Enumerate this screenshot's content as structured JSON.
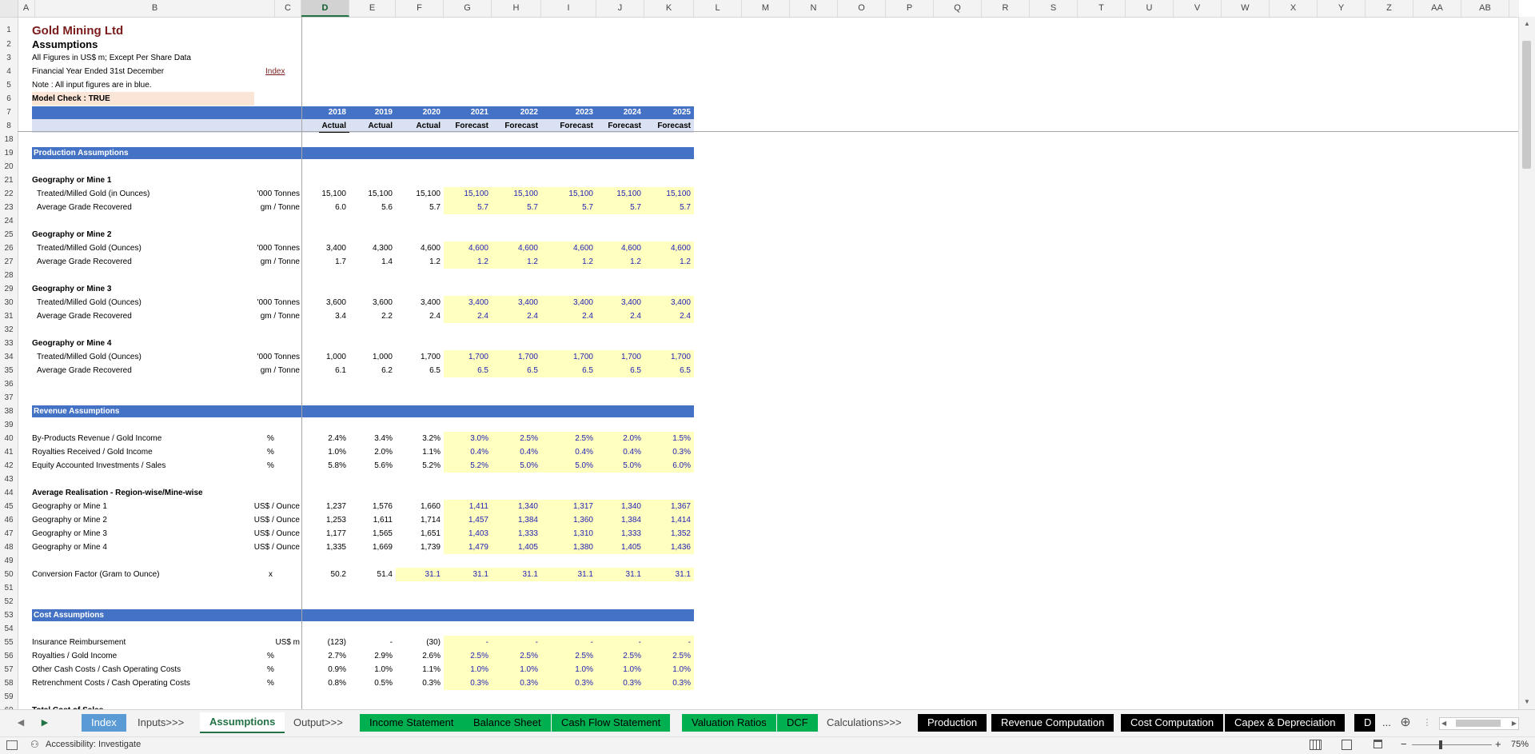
{
  "colors": {
    "band": "#4472c4",
    "header_light": "#d9e1f2",
    "input_fill": "#ffffc0",
    "input_text": "#1f1fb4",
    "title": "#7b1c1c",
    "check_fill": "#fbe5d6",
    "tab_green": "#00b050",
    "tab_black": "#000000",
    "tab_blue": "#5b9bd5",
    "selected_col": "#217346"
  },
  "column_letters": [
    "A",
    "B",
    "C",
    "D",
    "E",
    "F",
    "G",
    "H",
    "I",
    "J",
    "K",
    "L",
    "M",
    "N",
    "O",
    "P",
    "Q",
    "R",
    "S",
    "T",
    "U",
    "V",
    "W",
    "X",
    "Y",
    "Z",
    "AA",
    "AB"
  ],
  "row_numbers": [
    1,
    2,
    3,
    4,
    5,
    6,
    7,
    8,
    18,
    19,
    20,
    21,
    22,
    23,
    24,
    25,
    26,
    27,
    28,
    29,
    30,
    31,
    32,
    33,
    34,
    35,
    36,
    37,
    38,
    39,
    40,
    41,
    42,
    43,
    44,
    45,
    46,
    47,
    48,
    49,
    50,
    51,
    52,
    53,
    54,
    55,
    56,
    57,
    58,
    59,
    60
  ],
  "header": {
    "company": "Gold Mining Ltd",
    "sheet_title": "Assumptions",
    "note1": "All Figures in US$ m; Except Per Share Data",
    "note2": "Financial Year Ended 31st December",
    "index_link": "Index",
    "note3": "Note :  All input figures are in blue.",
    "model_check": "Model Check : TRUE",
    "years": [
      "2018",
      "2019",
      "2020",
      "2021",
      "2022",
      "2023",
      "2024",
      "2025"
    ],
    "statuses": [
      "Actual",
      "Actual",
      "Actual",
      "Forecast",
      "Forecast",
      "Forecast",
      "Forecast",
      "Forecast"
    ]
  },
  "sections": {
    "production": "Production Assumptions",
    "revenue": "Revenue Assumptions",
    "cost": "Cost Assumptions"
  },
  "production": {
    "mine1": {
      "title": "Geography or Mine 1",
      "rows": [
        {
          "label": "Treated/Milled Gold (in Ounces)",
          "unit": "'000 Tonnes",
          "values": [
            "15,100",
            "15,100",
            "15,100",
            "15,100",
            "15,100",
            "15,100",
            "15,100",
            "15,100"
          ]
        },
        {
          "label": "Average Grade Recovered",
          "unit": "gm / Tonne",
          "values": [
            "6.0",
            "5.6",
            "5.7",
            "5.7",
            "5.7",
            "5.7",
            "5.7",
            "5.7"
          ]
        }
      ]
    },
    "mine2": {
      "title": "Geography or Mine 2",
      "rows": [
        {
          "label": "Treated/Milled Gold (Ounces)",
          "unit": "'000 Tonnes",
          "values": [
            "3,400",
            "4,300",
            "4,600",
            "4,600",
            "4,600",
            "4,600",
            "4,600",
            "4,600"
          ]
        },
        {
          "label": "Average Grade Recovered",
          "unit": "gm / Tonne",
          "values": [
            "1.7",
            "1.4",
            "1.2",
            "1.2",
            "1.2",
            "1.2",
            "1.2",
            "1.2"
          ]
        }
      ]
    },
    "mine3": {
      "title": "Geography or Mine 3",
      "rows": [
        {
          "label": "Treated/Milled Gold (Ounces)",
          "unit": "'000 Tonnes",
          "values": [
            "3,600",
            "3,600",
            "3,400",
            "3,400",
            "3,400",
            "3,400",
            "3,400",
            "3,400"
          ]
        },
        {
          "label": "Average Grade Recovered",
          "unit": "gm / Tonne",
          "values": [
            "3.4",
            "2.2",
            "2.4",
            "2.4",
            "2.4",
            "2.4",
            "2.4",
            "2.4"
          ]
        }
      ]
    },
    "mine4": {
      "title": "Geography or Mine 4",
      "rows": [
        {
          "label": "Treated/Milled Gold (Ounces)",
          "unit": "'000 Tonnes",
          "values": [
            "1,000",
            "1,000",
            "1,700",
            "1,700",
            "1,700",
            "1,700",
            "1,700",
            "1,700"
          ]
        },
        {
          "label": "Average Grade Recovered",
          "unit": "gm / Tonne",
          "values": [
            "6.1",
            "6.2",
            "6.5",
            "6.5",
            "6.5",
            "6.5",
            "6.5",
            "6.5"
          ]
        }
      ]
    }
  },
  "revenue": {
    "ratios": [
      {
        "label": "By-Products Revenue / Gold Income",
        "unit": "%",
        "values": [
          "2.4%",
          "3.4%",
          "3.2%",
          "3.0%",
          "2.5%",
          "2.5%",
          "2.0%",
          "1.5%"
        ]
      },
      {
        "label": "Royalties Received / Gold Income",
        "unit": "%",
        "values": [
          "1.0%",
          "2.0%",
          "1.1%",
          "0.4%",
          "0.4%",
          "0.4%",
          "0.4%",
          "0.3%"
        ]
      },
      {
        "label": "Equity Accounted Investments / Sales",
        "unit": "%",
        "values": [
          "5.8%",
          "5.6%",
          "5.2%",
          "5.2%",
          "5.0%",
          "5.0%",
          "5.0%",
          "6.0%"
        ]
      }
    ],
    "realisation_title": "Average Realisation - Region-wise/Mine-wise",
    "realisation": [
      {
        "label": "Geography or Mine 1",
        "unit": "US$ / Ounce",
        "values": [
          "1,237",
          "1,576",
          "1,660",
          "1,411",
          "1,340",
          "1,317",
          "1,340",
          "1,367"
        ]
      },
      {
        "label": "Geography or Mine 2",
        "unit": "US$ / Ounce",
        "values": [
          "1,253",
          "1,611",
          "1,714",
          "1,457",
          "1,384",
          "1,360",
          "1,384",
          "1,414"
        ]
      },
      {
        "label": "Geography or Mine 3",
        "unit": "US$ / Ounce",
        "values": [
          "1,177",
          "1,565",
          "1,651",
          "1,403",
          "1,333",
          "1,310",
          "1,333",
          "1,352"
        ]
      },
      {
        "label": "Geography or Mine 4",
        "unit": "US$ / Ounce",
        "values": [
          "1,335",
          "1,669",
          "1,739",
          "1,479",
          "1,405",
          "1,380",
          "1,405",
          "1,436"
        ]
      }
    ],
    "conversion": {
      "label": "Conversion Factor (Gram to Ounce)",
      "unit": "x",
      "values": [
        "50.2",
        "51.4",
        "31.1",
        "31.1",
        "31.1",
        "31.1",
        "31.1",
        "31.1"
      ]
    }
  },
  "cost": {
    "rows": [
      {
        "label": "Insurance Reimbursement",
        "unit": "US$ m",
        "values": [
          "(123)",
          "-",
          "(30)",
          "-",
          "-",
          "-",
          "-",
          "-"
        ]
      },
      {
        "label": "Royalties / Gold Income",
        "unit": "%",
        "values": [
          "2.7%",
          "2.9%",
          "2.6%",
          "2.5%",
          "2.5%",
          "2.5%",
          "2.5%",
          "2.5%"
        ]
      },
      {
        "label": "Other Cash Costs / Cash Operating Costs",
        "unit": "%",
        "values": [
          "0.9%",
          "1.0%",
          "1.1%",
          "1.0%",
          "1.0%",
          "1.0%",
          "1.0%",
          "1.0%"
        ]
      },
      {
        "label": "Retrenchment Costs / Cash Operating Costs",
        "unit": "%",
        "values": [
          "0.8%",
          "0.5%",
          "0.3%",
          "0.3%",
          "0.3%",
          "0.3%",
          "0.3%",
          "0.3%"
        ]
      }
    ],
    "total_partial": "Total Cost of Sales"
  },
  "tabs": [
    {
      "label": "Index",
      "style": "blue"
    },
    {
      "label": "Inputs>>>",
      "style": "plain"
    },
    {
      "label": "Assumptions",
      "style": "active"
    },
    {
      "label": "Output>>>",
      "style": "plain"
    },
    {
      "label": "Income Statement",
      "style": "green"
    },
    {
      "label": "Balance Sheet",
      "style": "green"
    },
    {
      "label": "Cash Flow Statement",
      "style": "green"
    },
    {
      "label": "Valuation Ratios",
      "style": "green"
    },
    {
      "label": "DCF",
      "style": "green"
    },
    {
      "label": "Calculations>>>",
      "style": "plain"
    },
    {
      "label": "Production",
      "style": "black"
    },
    {
      "label": "Revenue Computation",
      "style": "black"
    },
    {
      "label": "Cost Computation",
      "style": "black"
    },
    {
      "label": "Capex & Depreciation",
      "style": "black"
    },
    {
      "label": "D",
      "style": "black"
    }
  ],
  "tab_overflow": "...",
  "status": {
    "accessibility": "Accessibility: Investigate",
    "zoom": "75%",
    "zoom_level": 0.75
  }
}
